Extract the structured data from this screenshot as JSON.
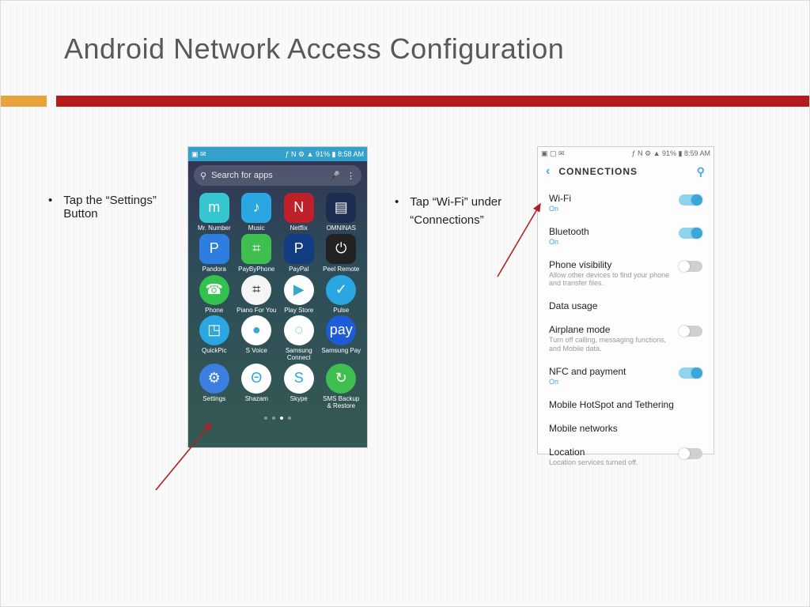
{
  "title": "Android Network Access Configuration",
  "bullets": {
    "b1": "Tap the “Settings” Button",
    "b2": "Tap “Wi-Fi” under “Connections”"
  },
  "phone1": {
    "status_left": "▣ ✉",
    "status_right": "ƒ N ⚙ ▲ 91% ▮ 8:58 AM",
    "search_placeholder": "Search for apps",
    "apps": [
      {
        "label": "Mr. Number",
        "color": "#35c6d0",
        "glyph": "m"
      },
      {
        "label": "Music",
        "color": "#2aa6e2",
        "glyph": "♪"
      },
      {
        "label": "Netflix",
        "color": "#c0202a",
        "glyph": "N"
      },
      {
        "label": "OMNINAS",
        "color": "#1d2d50",
        "glyph": "▤"
      },
      {
        "label": "Pandora",
        "color": "#2e7de0",
        "glyph": "P"
      },
      {
        "label": "PayByPhone",
        "color": "#3fbf4f",
        "glyph": "⌗"
      },
      {
        "label": "PayPal",
        "color": "#123d82",
        "glyph": "P"
      },
      {
        "label": "Peel Remote",
        "color": "#222",
        "glyph": "⏻"
      },
      {
        "label": "Phone",
        "color": "#32c24d",
        "glyph": "☎"
      },
      {
        "label": "Piano For You",
        "color": "#f5f5f5",
        "glyph": "⌗",
        "text": "#333"
      },
      {
        "label": "Play Store",
        "color": "#fff",
        "glyph": "▶",
        "text": "#3ac"
      },
      {
        "label": "Pulse",
        "color": "#2aa6e2",
        "glyph": "✓"
      },
      {
        "label": "QuickPic",
        "color": "#2aa6e2",
        "glyph": "◳"
      },
      {
        "label": "S Voice",
        "color": "#fff",
        "glyph": "●",
        "text": "#3ba7d9"
      },
      {
        "label": "Samsung Connect",
        "color": "#fff",
        "glyph": "◌",
        "text": "#3ba7d9"
      },
      {
        "label": "Samsung Pay",
        "color": "#1d5cd8",
        "glyph": "pay"
      },
      {
        "label": "Settings",
        "color": "#3d7fe0",
        "glyph": "⚙"
      },
      {
        "label": "Shazam",
        "color": "#fff",
        "glyph": "Θ",
        "text": "#2aa6e2"
      },
      {
        "label": "Skype",
        "color": "#fff",
        "glyph": "S",
        "text": "#2aa6e2"
      },
      {
        "label": "SMS Backup & Restore",
        "color": "#3fbf4f",
        "glyph": "↻"
      }
    ]
  },
  "phone2": {
    "status_left": "▣ ▢ ✉",
    "status_right": "ƒ N ⚙ ▲ 91% ▮ 8:59 AM",
    "header": "CONNECTIONS",
    "rows": [
      {
        "name": "Wi-Fi",
        "sub": "On",
        "on": true,
        "toggle": true,
        "toggled": true
      },
      {
        "name": "Bluetooth",
        "sub": "On",
        "on": true,
        "toggle": true,
        "toggled": true
      },
      {
        "name": "Phone visibility",
        "sub": "Allow other devices to find your phone and transfer files.",
        "on": false,
        "toggle": true,
        "toggled": false
      },
      {
        "name": "Data usage",
        "sub": "",
        "on": false,
        "toggle": false
      },
      {
        "name": "Airplane mode",
        "sub": "Turn off calling, messaging functions, and Mobile data.",
        "on": false,
        "toggle": true,
        "toggled": false
      },
      {
        "name": "NFC and payment",
        "sub": "On",
        "on": true,
        "toggle": true,
        "toggled": true
      },
      {
        "name": "Mobile HotSpot and Tethering",
        "sub": "",
        "on": false,
        "toggle": false
      },
      {
        "name": "Mobile networks",
        "sub": "",
        "on": false,
        "toggle": false
      },
      {
        "name": "Location",
        "sub": "Location services turned off.",
        "on": false,
        "toggle": true,
        "toggled": false
      }
    ]
  }
}
